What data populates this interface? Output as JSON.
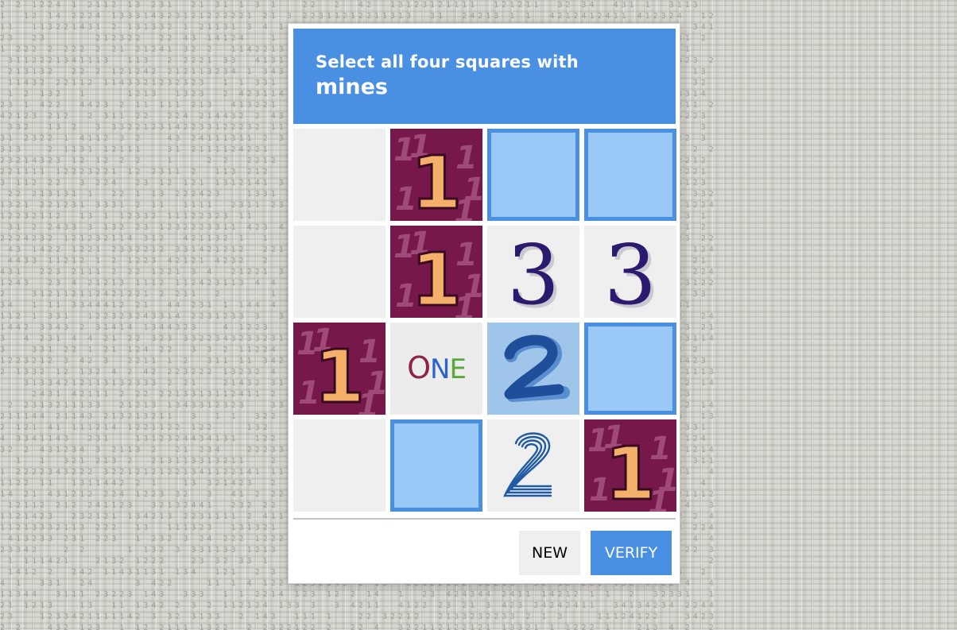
{
  "prompt": {
    "line1": "Select all four squares with",
    "line2": "mines"
  },
  "tiles": [
    {
      "row": 1,
      "col": 1,
      "kind": "empty",
      "selected": false
    },
    {
      "row": 1,
      "col": 2,
      "kind": "number-one-maroon",
      "selected": false
    },
    {
      "row": 1,
      "col": 3,
      "kind": "blank",
      "selected": true
    },
    {
      "row": 1,
      "col": 4,
      "kind": "blank",
      "selected": true
    },
    {
      "row": 2,
      "col": 1,
      "kind": "empty",
      "selected": false
    },
    {
      "row": 2,
      "col": 2,
      "kind": "number-one-maroon",
      "selected": false
    },
    {
      "row": 2,
      "col": 3,
      "kind": "number-three-serif",
      "selected": false
    },
    {
      "row": 2,
      "col": 4,
      "kind": "number-three-serif",
      "selected": false
    },
    {
      "row": 3,
      "col": 1,
      "kind": "number-one-maroon",
      "selected": false
    },
    {
      "row": 3,
      "col": 2,
      "kind": "word-one",
      "text": "ONE",
      "selected": false
    },
    {
      "row": 3,
      "col": 3,
      "kind": "number-two-brush",
      "selected": false
    },
    {
      "row": 3,
      "col": 4,
      "kind": "blank",
      "selected": true
    },
    {
      "row": 4,
      "col": 1,
      "kind": "empty",
      "selected": false
    },
    {
      "row": 4,
      "col": 2,
      "kind": "blank",
      "selected": true
    },
    {
      "row": 4,
      "col": 3,
      "kind": "number-two-striped",
      "selected": false
    },
    {
      "row": 4,
      "col": 4,
      "kind": "number-one-maroon",
      "selected": false
    }
  ],
  "buttons": {
    "new_label": "NEW",
    "verify_label": "VERIFY"
  },
  "colors": {
    "accent": "#4a90e2",
    "selected_fill": "#9bc9f7",
    "maroon": "#76194a",
    "numeral_orange": "#f4b06a",
    "numeral_purple": "#2c1a6e"
  }
}
